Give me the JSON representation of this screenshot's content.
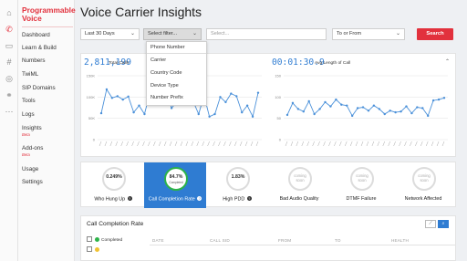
{
  "app": {
    "brand": "Programmable Voice"
  },
  "sidebar": {
    "items": [
      {
        "label": "Dashboard"
      },
      {
        "label": "Learn & Build"
      },
      {
        "label": "Numbers"
      },
      {
        "label": "TwiML"
      },
      {
        "label": "SIP Domains"
      },
      {
        "label": "Tools"
      },
      {
        "label": "Logs"
      },
      {
        "label": "Insights",
        "badge": "Beta"
      },
      {
        "label": "Add-ons",
        "badge": "Beta"
      },
      {
        "label": "Usage"
      },
      {
        "label": "Settings"
      }
    ]
  },
  "rail_icons": [
    "home-icon",
    "phone-icon",
    "chat-icon",
    "hash-icon",
    "sip-icon",
    "link-icon",
    "more-icon"
  ],
  "header": {
    "title": "Voice Carrier Insights"
  },
  "controls": {
    "range": {
      "value": "Last 30 Days"
    },
    "filter": {
      "value": "Select filter..."
    },
    "search": {
      "placeholder": "Select..."
    },
    "direction": {
      "value": "To or From"
    },
    "search_button": "Search"
  },
  "filter_dropdown": {
    "options": [
      "Phone Number",
      "Carrier",
      "Country Code",
      "Device Type",
      "Number Prefix"
    ]
  },
  "stats": {
    "total_calls": {
      "value": "2,811,199",
      "label": "Total Calls"
    },
    "avg_length": {
      "value": "00:01:30.9",
      "label": "Avg Length of Call"
    }
  },
  "chart_data": [
    {
      "type": "line",
      "title": "Total Calls",
      "ylim": [
        0,
        150000
      ],
      "yticks": [
        "150K",
        "100K",
        "50K",
        "0"
      ],
      "color": "#4a90d9",
      "values": [
        62000,
        118000,
        98000,
        102000,
        94000,
        101000,
        64000,
        80000,
        60000,
        110000,
        96000,
        122000,
        116000,
        74000,
        90000,
        98000,
        100000,
        90000,
        60000,
        104000,
        54000,
        60000,
        100000,
        88000,
        108000,
        102000,
        64000,
        80000,
        54000,
        110000
      ]
    },
    {
      "type": "line",
      "title": "Avg Length of Call",
      "ylim": [
        0,
        150
      ],
      "yticks": [
        "150",
        "100",
        "50",
        "0"
      ],
      "color": "#4a90d9",
      "values": [
        58,
        86,
        72,
        66,
        90,
        60,
        72,
        88,
        78,
        94,
        82,
        80,
        56,
        74,
        76,
        68,
        80,
        72,
        60,
        68,
        64,
        66,
        78,
        62,
        76,
        74,
        56,
        92,
        94,
        98
      ]
    }
  ],
  "metrics": [
    {
      "value": "0.249%",
      "sub": "",
      "label": "Who Hung Up",
      "state": "normal",
      "help": "?"
    },
    {
      "value": "84.7%",
      "sub": "Completed",
      "label": "Call Completion Rate",
      "state": "selected",
      "help": "?"
    },
    {
      "value": "1.83%",
      "sub": "",
      "label": "High PDD",
      "state": "normal",
      "help": "?"
    },
    {
      "value": "coming soon",
      "sub": "",
      "label": "Bad Audio Quality",
      "state": "soon",
      "help": ""
    },
    {
      "value": "coming soon",
      "sub": "",
      "label": "DTMF Failure",
      "state": "soon",
      "help": ""
    },
    {
      "value": "coming soon",
      "sub": "",
      "label": "Network Affected",
      "state": "soon",
      "help": ""
    }
  ],
  "ccr": {
    "title": "Call Completion Rate",
    "columns": [
      "DATE",
      "CALL SID",
      "FROM",
      "TO",
      "HEALTH"
    ],
    "legend": [
      {
        "label": "Completed",
        "color": "#2db34a"
      },
      {
        "label": "",
        "color": "#f1c232"
      }
    ]
  }
}
